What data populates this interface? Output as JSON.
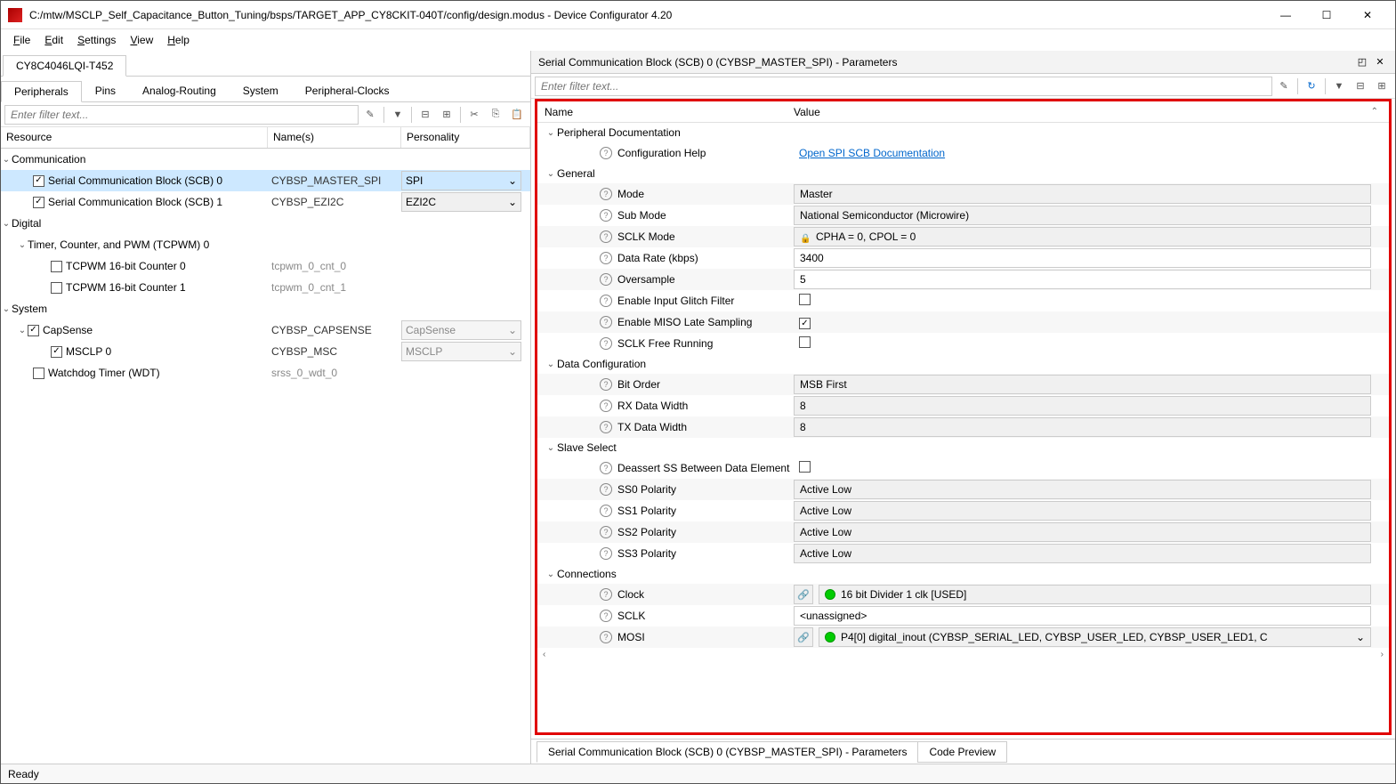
{
  "window": {
    "title": "C:/mtw/MSCLP_Self_Capacitance_Button_Tuning/bsps/TARGET_APP_CY8CKIT-040T/config/design.modus - Device Configurator 4.20"
  },
  "menu": {
    "file": "File",
    "edit": "Edit",
    "settings": "Settings",
    "view": "View",
    "help": "Help"
  },
  "device_tab": "CY8C4046LQI-T452",
  "subtabs": {
    "peripherals": "Peripherals",
    "pins": "Pins",
    "analog": "Analog-Routing",
    "system": "System",
    "clocks": "Peripheral-Clocks"
  },
  "filter_placeholder": "Enter filter text...",
  "tree_headers": {
    "resource": "Resource",
    "names": "Name(s)",
    "personality": "Personality"
  },
  "tree": {
    "comm": "Communication",
    "scb0": {
      "label": "Serial Communication Block (SCB) 0",
      "name": "CYBSP_MASTER_SPI",
      "pers": "SPI"
    },
    "scb1": {
      "label": "Serial Communication Block (SCB) 1",
      "name": "CYBSP_EZI2C",
      "pers": "EZI2C"
    },
    "digital": "Digital",
    "tcpwm": "Timer, Counter, and PWM (TCPWM) 0",
    "cnt0": {
      "label": "TCPWM 16-bit Counter 0",
      "name": "tcpwm_0_cnt_0"
    },
    "cnt1": {
      "label": "TCPWM 16-bit Counter 1",
      "name": "tcpwm_0_cnt_1"
    },
    "system": "System",
    "capsense": {
      "label": "CapSense",
      "name": "CYBSP_CAPSENSE",
      "pers": "CapSense"
    },
    "msclp": {
      "label": "MSCLP 0",
      "name": "CYBSP_MSC",
      "pers": "MSCLP"
    },
    "wdt": {
      "label": "Watchdog Timer (WDT)",
      "name": "srss_0_wdt_0"
    }
  },
  "panel": {
    "title": "Serial Communication Block (SCB) 0 (CYBSP_MASTER_SPI) - Parameters",
    "header_name": "Name",
    "header_value": "Value"
  },
  "sections": {
    "doc": "Peripheral Documentation",
    "cfg_help": "Configuration Help",
    "cfg_help_link": "Open SPI SCB Documentation",
    "general": "General",
    "mode": {
      "n": "Mode",
      "v": "Master"
    },
    "submode": {
      "n": "Sub Mode",
      "v": "National Semiconductor (Microwire)"
    },
    "sclkmode": {
      "n": "SCLK Mode",
      "v": "CPHA = 0, CPOL = 0"
    },
    "datarate": {
      "n": "Data Rate (kbps)",
      "v": "3400"
    },
    "oversample": {
      "n": "Oversample",
      "v": "5"
    },
    "glitch": {
      "n": "Enable Input Glitch Filter"
    },
    "miso": {
      "n": "Enable MISO Late Sampling"
    },
    "freerun": {
      "n": "SCLK Free Running"
    },
    "datacfg": "Data Configuration",
    "bitorder": {
      "n": "Bit Order",
      "v": "MSB First"
    },
    "rxwidth": {
      "n": "RX Data Width",
      "v": "8"
    },
    "txwidth": {
      "n": "TX Data Width",
      "v": "8"
    },
    "slave": "Slave Select",
    "deassert": {
      "n": "Deassert SS Between Data Element"
    },
    "ss0": {
      "n": "SS0 Polarity",
      "v": "Active Low"
    },
    "ss1": {
      "n": "SS1 Polarity",
      "v": "Active Low"
    },
    "ss2": {
      "n": "SS2 Polarity",
      "v": "Active Low"
    },
    "ss3": {
      "n": "SS3 Polarity",
      "v": "Active Low"
    },
    "conn": "Connections",
    "clock": {
      "n": "Clock",
      "v": "16 bit Divider 1 clk [USED]"
    },
    "sclk": {
      "n": "SCLK",
      "v": "<unassigned>"
    },
    "mosi": {
      "n": "MOSI",
      "v": "P4[0] digital_inout (CYBSP_SERIAL_LED, CYBSP_USER_LED, CYBSP_USER_LED1, C"
    }
  },
  "bottom_tabs": {
    "params": "Serial Communication Block (SCB) 0 (CYBSP_MASTER_SPI) - Parameters",
    "code": "Code Preview"
  },
  "status": "Ready"
}
